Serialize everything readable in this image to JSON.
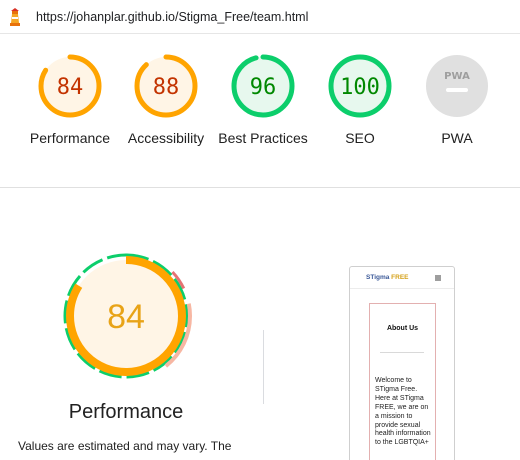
{
  "browser": {
    "url": "https://johanplar.github.io/Stigma_Free/team.html"
  },
  "colors": {
    "pass": "#0cce6b",
    "average": "#ffa400",
    "average_text": "#c33300",
    "pass_text": "#008800",
    "na": "#e0e0e0"
  },
  "gauges": [
    {
      "label": "Performance",
      "score": "84",
      "status": "average"
    },
    {
      "label": "Accessibility",
      "score": "88",
      "status": "average"
    },
    {
      "label": "Best Practices",
      "score": "96",
      "status": "pass"
    },
    {
      "label": "SEO",
      "score": "100",
      "status": "pass"
    },
    {
      "label": "PWA",
      "score": "",
      "status": "na",
      "badge": "PWA"
    }
  ],
  "performance": {
    "score": "84",
    "title": "Performance",
    "note": "Values are estimated and may vary. The"
  },
  "screenshot": {
    "logo_part1": "STigma",
    "logo_part2": "FREE",
    "about_heading": "About Us",
    "about_text": "Welcome to STigma Free. Here at STigma FREE, we are on a mission to provide sexual health information to the LGBTQIA+"
  }
}
